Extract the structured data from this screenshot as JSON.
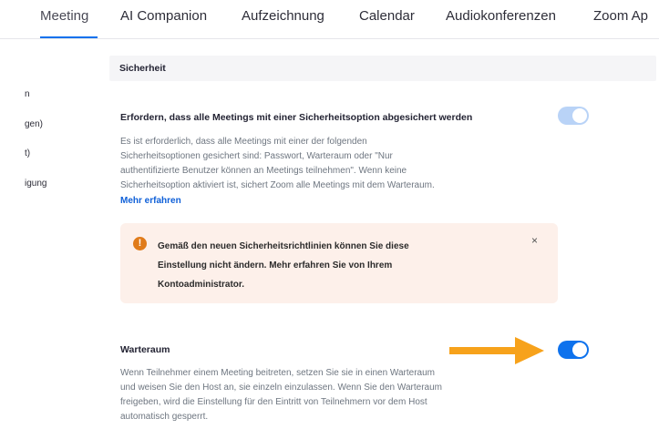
{
  "tabs": [
    "Meeting",
    "AI Companion",
    "Aufzeichnung",
    "Calendar",
    "Audiokonferenzen",
    "Zoom Ap"
  ],
  "sidebar": [
    "n",
    "gen)",
    "t)",
    "igung"
  ],
  "section": {
    "title": "Sicherheit"
  },
  "setting_secure": {
    "title": "Erfordern, dass alle Meetings mit einer Sicherheitsoption abgesichert werden",
    "desc_lines": [
      "Es ist erforderlich, dass alle Meetings mit einer der folgenden",
      "Sicherheitsoptionen gesichert sind: Passwort, Warteraum oder \"Nur",
      "authentifizierte Benutzer können an Meetings teilnehmen\". Wenn keine",
      "Sicherheitsoption aktiviert ist, sichert Zoom alle Meetings mit dem Warteraum."
    ],
    "link": "Mehr erfahren",
    "enabled": true,
    "locked": true
  },
  "alert": {
    "icon": "!",
    "lines": [
      "Gemäß den neuen Sicherheitsrichtlinien können Sie diese",
      "Einstellung nicht ändern. Mehr erfahren Sie von Ihrem",
      "Kontoadministrator."
    ],
    "close": "×"
  },
  "setting_waiting_room": {
    "title": "Warteraum",
    "desc_lines": [
      "Wenn Teilnehmer einem Meeting beitreten, setzen Sie sie in einen Warteraum",
      "und weisen Sie den Host an, sie einzeln einzulassen. Wenn Sie den Warteraum",
      "freigeben, wird die Einstellung für den Eintritt von Teilnehmern vor dem Host",
      "automatisch gesperrt."
    ],
    "enabled": true
  },
  "colors": {
    "accent": "#0e72ed",
    "arrow": "#f7a21b",
    "alert_bg": "#fdf0ea",
    "alert_icon": "#e07b1a"
  }
}
